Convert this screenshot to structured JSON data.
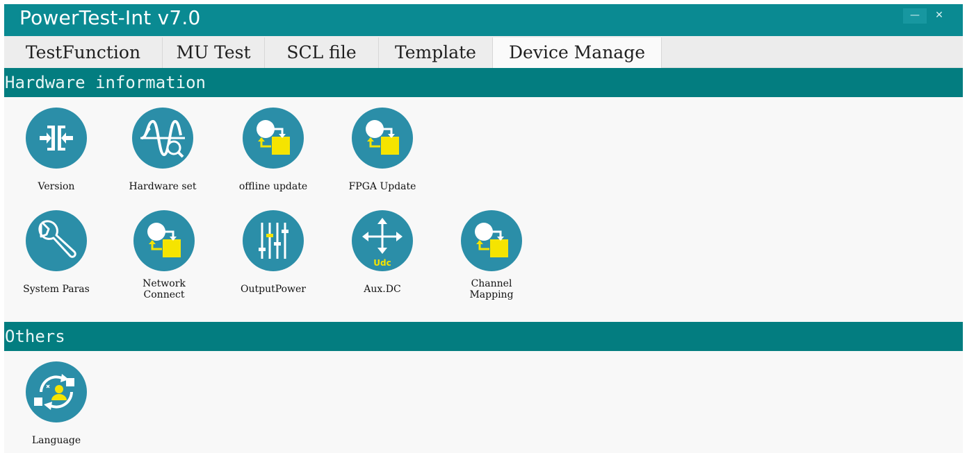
{
  "app": {
    "title": "PowerTest-Int v7.0"
  },
  "window_controls": {
    "minimize": "—",
    "close": "✕"
  },
  "tabs": [
    {
      "label": "TestFunction"
    },
    {
      "label": "MU Test"
    },
    {
      "label": "SCL file"
    },
    {
      "label": "Template"
    },
    {
      "label": "Device Manage",
      "active": true
    }
  ],
  "sections": [
    {
      "title": "Hardware information",
      "items": [
        {
          "label": "Version",
          "icon": "version-icon"
        },
        {
          "label": "Hardware set",
          "icon": "hardware-set-icon"
        },
        {
          "label": "offline update",
          "icon": "update-transfer-icon"
        },
        {
          "label": "FPGA Update",
          "icon": "update-transfer-icon"
        },
        {
          "label": "System Paras",
          "icon": "wrench-icon"
        },
        {
          "label": "Network\nConnect",
          "icon": "update-transfer-icon"
        },
        {
          "label": "OutputPower",
          "icon": "sliders-icon"
        },
        {
          "label": "Aux.DC",
          "icon": "aux-dc-move-icon",
          "icon_text": "Udc"
        },
        {
          "label": "Channel\nMapping",
          "icon": "update-transfer-icon"
        }
      ]
    },
    {
      "title": "Others",
      "items": [
        {
          "label": "Language",
          "icon": "language-icon"
        }
      ]
    }
  ],
  "colors": {
    "titlebar": "#0a8a92",
    "section_header": "#037d80",
    "icon_circle": "#2b8ea8",
    "icon_accent": "#f5e400"
  }
}
